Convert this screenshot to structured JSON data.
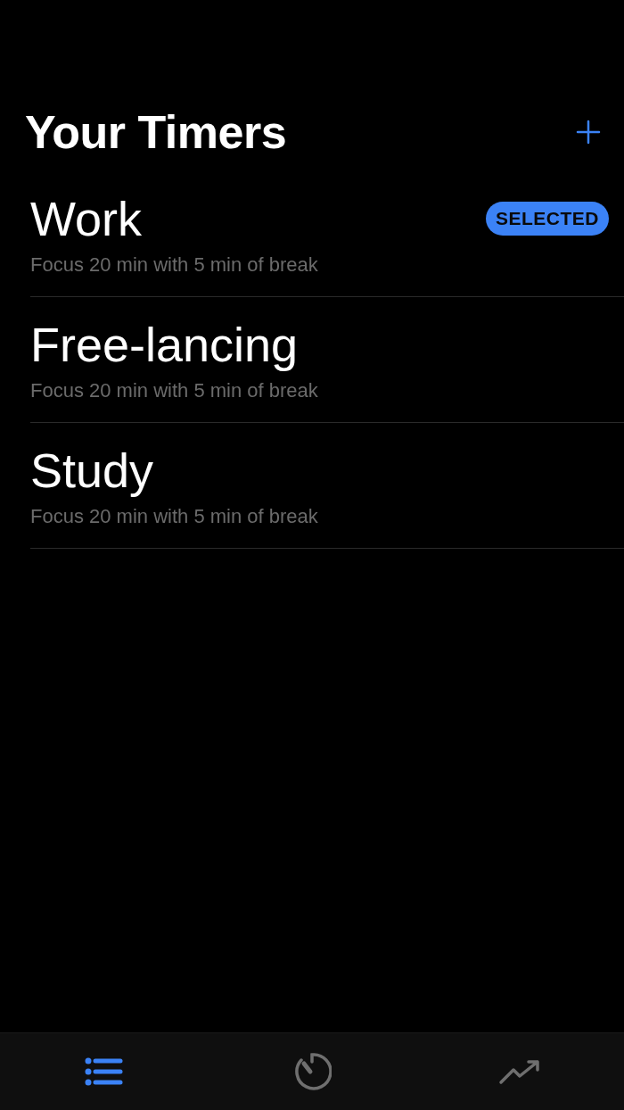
{
  "header": {
    "title": "Your Timers"
  },
  "badge_label": "SELECTED",
  "timers": [
    {
      "name": "Work",
      "description": "Focus 20 min with 5 min of break",
      "selected": true
    },
    {
      "name": "Free-lancing",
      "description": "Focus 20 min with 5 min of break",
      "selected": false
    },
    {
      "name": "Study",
      "description": "Focus 20 min with 5 min of break",
      "selected": false
    }
  ],
  "tab_bar": [
    {
      "kind": "list",
      "selected": true
    },
    {
      "kind": "timer",
      "selected": false
    },
    {
      "kind": "stats",
      "selected": false
    }
  ]
}
